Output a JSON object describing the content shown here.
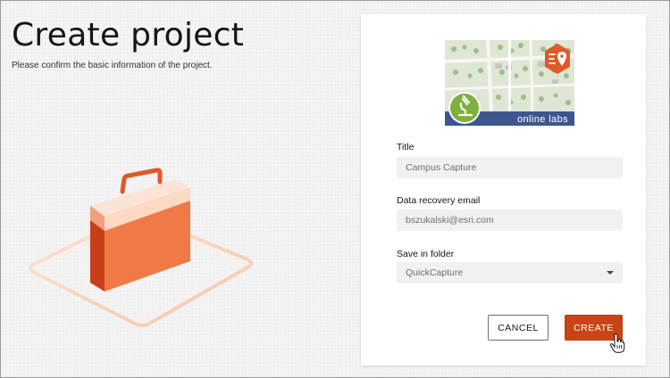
{
  "header": {
    "title": "Create project",
    "subtitle": "Please confirm the basic information of the project."
  },
  "banner": {
    "caption": "online labs",
    "icons": [
      "microscope-icon",
      "quickcapture-logo-icon"
    ]
  },
  "form": {
    "title_label": "Title",
    "title_value": "Campus Capture",
    "email_label": "Data recovery email",
    "email_value": "bszukalski@esri.com",
    "folder_label": "Save in folder",
    "folder_value": "QuickCapture"
  },
  "actions": {
    "cancel_label": "CANCEL",
    "create_label": "CREATE"
  },
  "colors": {
    "accent": "#c94516",
    "banner_strip": "#3d5690",
    "briefcase": "#f07a45"
  }
}
